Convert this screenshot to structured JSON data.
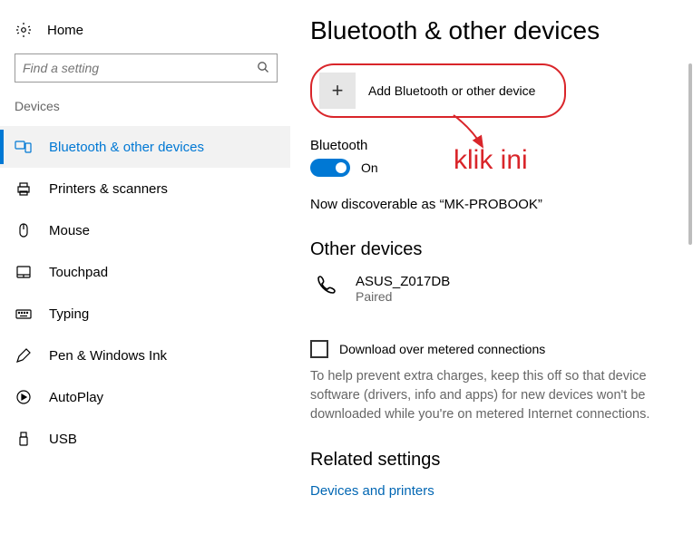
{
  "sidebar": {
    "home_label": "Home",
    "search_placeholder": "Find a setting",
    "section_label": "Devices",
    "items": [
      {
        "label": "Bluetooth & other devices",
        "active": true
      },
      {
        "label": "Printers & scanners"
      },
      {
        "label": "Mouse"
      },
      {
        "label": "Touchpad"
      },
      {
        "label": "Typing"
      },
      {
        "label": "Pen & Windows Ink"
      },
      {
        "label": "AutoPlay"
      },
      {
        "label": "USB"
      }
    ]
  },
  "main": {
    "title": "Bluetooth & other devices",
    "add_button_label": "Add Bluetooth or other device",
    "bluetooth_label": "Bluetooth",
    "toggle_state_label": "On",
    "discoverable_text": "Now discoverable as “MK-PROBOOK”",
    "other_devices_heading": "Other devices",
    "device": {
      "name": "ASUS_Z017DB",
      "status": "Paired"
    },
    "metered_checkbox_label": "Download over metered connections",
    "metered_help": "To help prevent extra charges, keep this off so that device software (drivers, info and apps) for new devices won't be downloaded while you're on metered Internet connections.",
    "related_heading": "Related settings",
    "related_link": "Devices and printers"
  },
  "annotation": {
    "text": "klik ini"
  },
  "colors": {
    "accent": "#0078d4",
    "annotation": "#d9252a",
    "link": "#0066b3"
  }
}
